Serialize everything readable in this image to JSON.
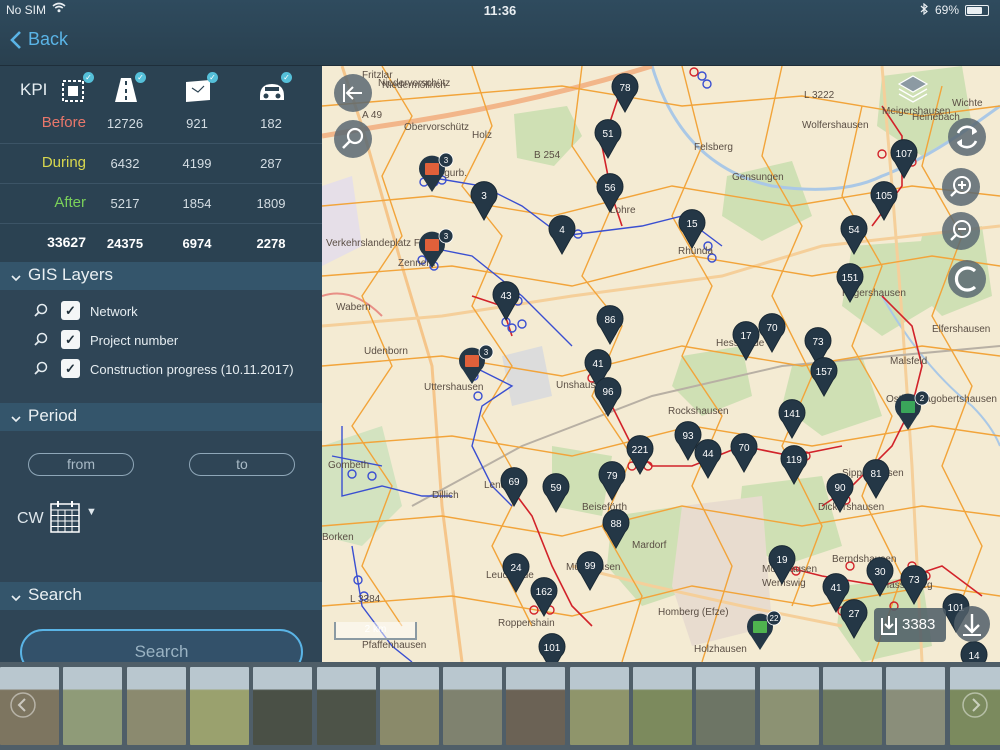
{
  "status": {
    "carrier": "No SIM",
    "time": "11:36",
    "battery": "69%",
    "battery_level": 0.69
  },
  "nav": {
    "back_label": "Back"
  },
  "kpi": {
    "header": "KPI",
    "icons": [
      "area-selection-icon",
      "road-icon",
      "map-sheet-icon",
      "vehicle-icon"
    ],
    "rows": [
      {
        "label": "Before",
        "color": "#e9776b",
        "values": [
          "12726",
          "921",
          "182"
        ]
      },
      {
        "label": "During",
        "color": "#d9d84e",
        "values": [
          "6432",
          "4199",
          "287"
        ]
      },
      {
        "label": "After",
        "color": "#7ad05a",
        "values": [
          "5217",
          "1854",
          "1809"
        ]
      }
    ],
    "total": {
      "label": "33627",
      "values": [
        "24375",
        "6974",
        "2278"
      ]
    }
  },
  "gis_layers": {
    "title": "GIS Layers",
    "items": [
      {
        "label": "Network",
        "checked": true
      },
      {
        "label": "Project number",
        "checked": true
      },
      {
        "label": "Construction progress (10.11.2017)",
        "checked": true
      }
    ]
  },
  "period": {
    "title": "Period",
    "from_label": "from",
    "to_label": "to",
    "cw_label": "CW"
  },
  "search": {
    "title": "Search",
    "button_label": "Search"
  },
  "map": {
    "scale_label": "2 km",
    "download_count": "3383",
    "place_labels": [
      {
        "t": "Fritzlar"
      },
      {
        "t": "Niedervorschütz"
      },
      {
        "t": "L 3222"
      },
      {
        "t": "Meigershausen"
      },
      {
        "t": "A 49"
      },
      {
        "t": "Obervorschütz"
      },
      {
        "t": "Holz"
      },
      {
        "t": "Felsberg"
      },
      {
        "t": "B 254"
      },
      {
        "t": "Gensungen"
      },
      {
        "t": "Lohre"
      },
      {
        "t": "Rhünda"
      },
      {
        "t": "Zennern"
      },
      {
        "t": "Wabern"
      },
      {
        "t": "Udenborn"
      },
      {
        "t": "Uttershausen"
      },
      {
        "t": "Hilgershausen"
      },
      {
        "t": "Elfershausen"
      },
      {
        "t": "Hesserode"
      },
      {
        "t": "Malsfeld"
      },
      {
        "t": "Ostheim"
      },
      {
        "t": "Dagobertshausen"
      },
      {
        "t": "Unshausen"
      },
      {
        "t": "Rockshausen"
      },
      {
        "t": "Lendorf"
      },
      {
        "t": "Beiseförth"
      },
      {
        "t": "Dickershausen"
      },
      {
        "t": "Mardorf"
      },
      {
        "t": "Homberg (Efze)"
      },
      {
        "t": "Mühlhausen"
      },
      {
        "t": "Leuderode"
      },
      {
        "t": "Roppershain"
      },
      {
        "t": "Holzhausen"
      },
      {
        "t": "Gombeth"
      },
      {
        "t": "Borken"
      },
      {
        "t": "L 3384"
      },
      {
        "t": "Pfaffenhausen"
      },
      {
        "t": "Dillich"
      },
      {
        "t": "Hasselberg"
      },
      {
        "t": "Wernswig"
      },
      {
        "t": "Berndshausen"
      },
      {
        "t": "Sipperhausen"
      },
      {
        "t": "Mörshausen"
      },
      {
        "t": "Verkehrslandeplatz Fritzlar"
      },
      {
        "t": "Wichte"
      },
      {
        "t": "Heinebach"
      },
      {
        "t": "Niedermöllrich"
      },
      {
        "t": "Obergurb."
      },
      {
        "t": "Wolfershausen"
      }
    ],
    "pins": [
      {
        "n": "78"
      },
      {
        "n": "51"
      },
      {
        "n": "56"
      },
      {
        "n": "3"
      },
      {
        "n": "4"
      },
      {
        "n": "15"
      },
      {
        "n": "107"
      },
      {
        "n": "105"
      },
      {
        "n": "54"
      },
      {
        "n": "151"
      },
      {
        "n": "43"
      },
      {
        "n": "86"
      },
      {
        "n": "41"
      },
      {
        "n": "96"
      },
      {
        "n": "17"
      },
      {
        "n": "70"
      },
      {
        "n": "73"
      },
      {
        "n": "157"
      },
      {
        "n": "141"
      },
      {
        "n": "93"
      },
      {
        "n": "44"
      },
      {
        "n": "70"
      },
      {
        "n": "119"
      },
      {
        "n": "221"
      },
      {
        "n": "79"
      },
      {
        "n": "69"
      },
      {
        "n": "59"
      },
      {
        "n": "90"
      },
      {
        "n": "81"
      },
      {
        "n": "88"
      },
      {
        "n": "24"
      },
      {
        "n": "162"
      },
      {
        "n": "99"
      },
      {
        "n": "19"
      },
      {
        "n": "41"
      },
      {
        "n": "30"
      },
      {
        "n": "73"
      },
      {
        "n": "27"
      },
      {
        "n": "101"
      },
      {
        "n": "101"
      },
      {
        "n": "14"
      }
    ],
    "clusters": [
      {
        "n": "3",
        "kind": "building"
      },
      {
        "n": "3",
        "kind": "building"
      },
      {
        "n": "3",
        "kind": "building"
      },
      {
        "n": "2",
        "kind": "vehicle"
      },
      {
        "n": "22",
        "kind": "road"
      }
    ]
  },
  "thumbnails": [
    {
      "c": "#7d7560"
    },
    {
      "c": "#8f9b78"
    },
    {
      "c": "#8b8a6f"
    },
    {
      "c": "#9aa16e"
    },
    {
      "c": "#4a5046"
    },
    {
      "c": "#4d5348"
    },
    {
      "c": "#8a8a6a"
    },
    {
      "c": "#7f826f"
    },
    {
      "c": "#6b6255"
    },
    {
      "c": "#8f956b"
    },
    {
      "c": "#7c8a5d"
    },
    {
      "c": "#6d7565"
    },
    {
      "c": "#8c9273"
    },
    {
      "c": "#6f7a60"
    },
    {
      "c": "#8a8e7a"
    },
    {
      "c": "#7b8a5e"
    }
  ]
}
